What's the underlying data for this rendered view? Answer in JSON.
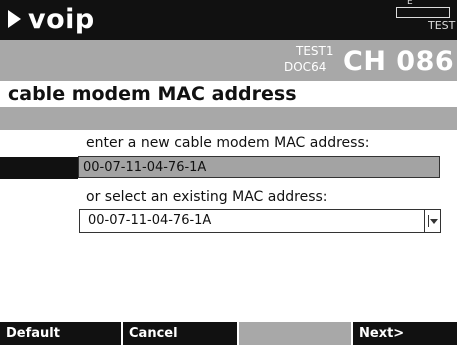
{
  "app": {
    "title": "voip"
  },
  "status": {
    "battery_label": "E",
    "test_label": "TEST"
  },
  "channel": {
    "test": "TEST1",
    "standard": "DOC64",
    "label": "CH 086"
  },
  "page": {
    "heading": "cable modem MAC address"
  },
  "form": {
    "new_mac_prompt": "enter a new cable modem MAC address:",
    "new_mac_value": "00-07-11-04-76-1A",
    "existing_mac_prompt": "or select an existing MAC address:",
    "existing_mac_selected": "00-07-11-04-76-1A"
  },
  "softkeys": {
    "key1": "Default",
    "key2": "Cancel",
    "key3": "",
    "key4": "Next>"
  },
  "colors": {
    "titlebar": "#111111",
    "gray": "#a8a8a8",
    "field": "#a3a3a3"
  }
}
